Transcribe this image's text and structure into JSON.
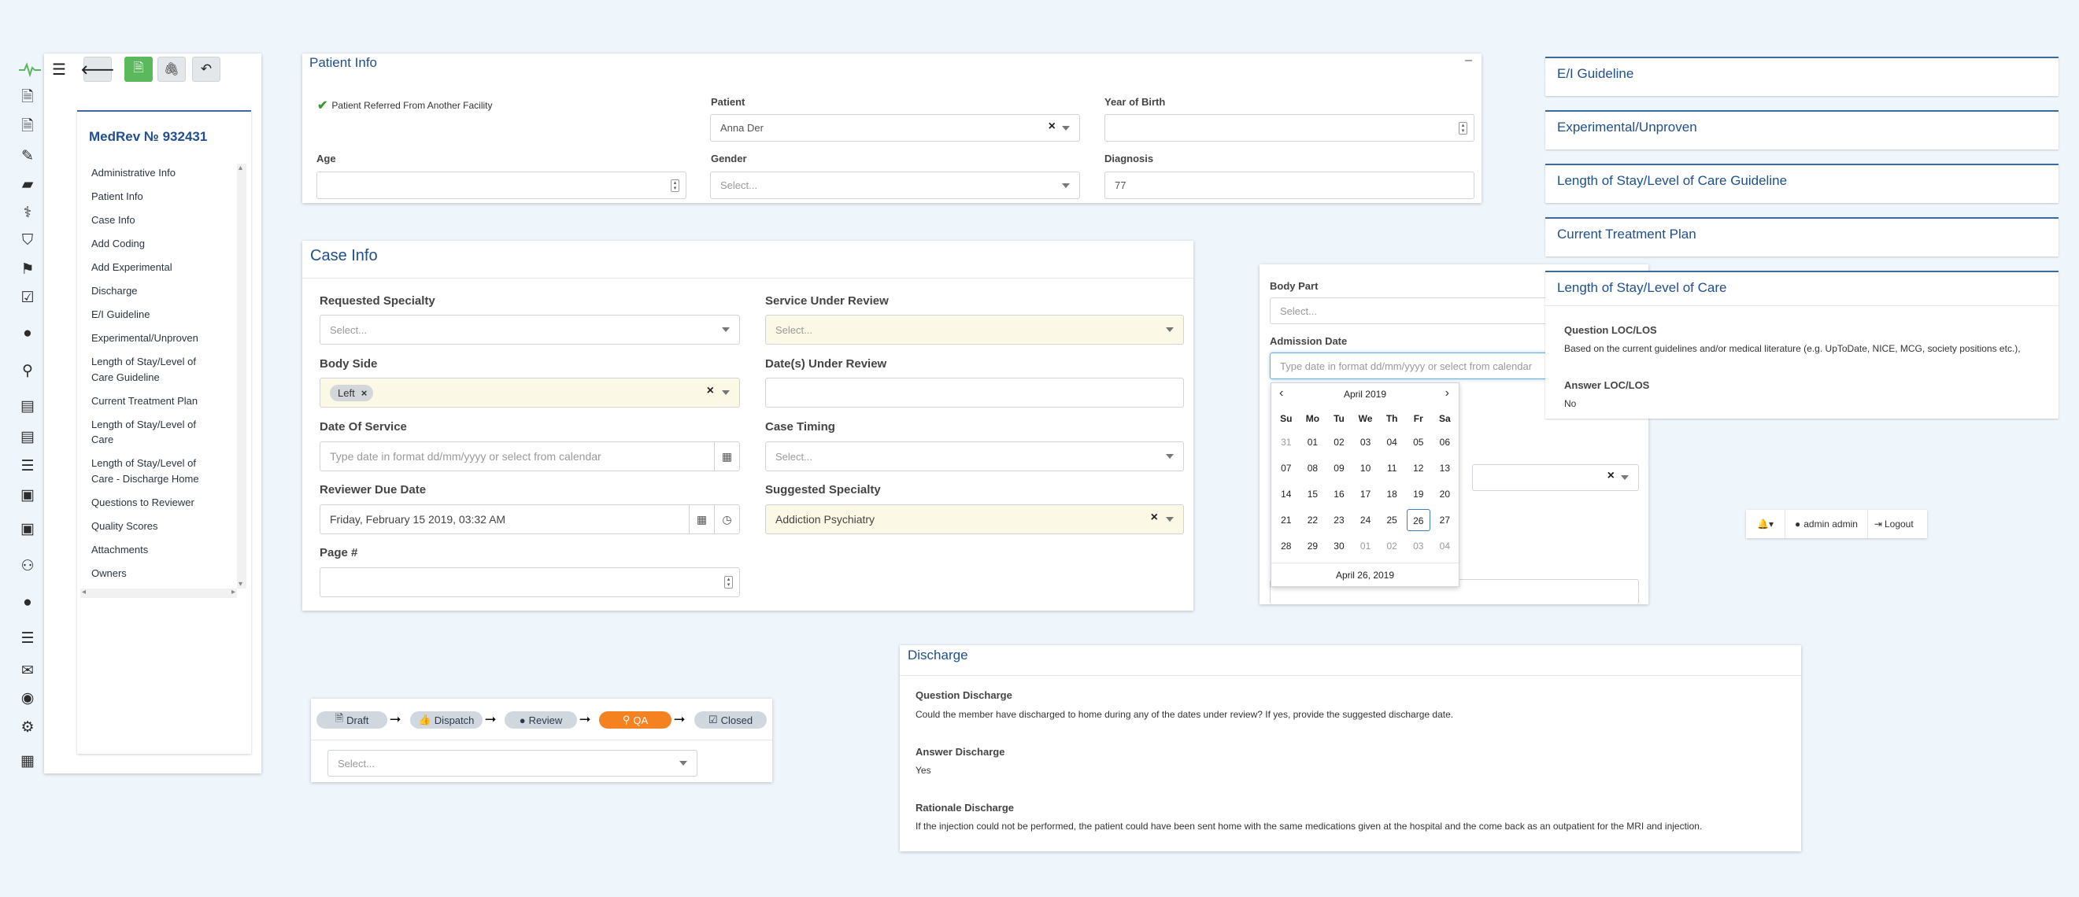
{
  "toolbar": {
    "menu_icon": "hamburger-icon",
    "back_icon": "arrow-left-icon",
    "file_icon": "file-icon",
    "attach_icon": "paperclip-icon",
    "undo_icon": "reply-icon"
  },
  "record": {
    "title": "MedRev № 932431"
  },
  "nav_items": [
    "Administrative Info",
    "Patient Info",
    "Case Info",
    "Add Coding",
    "Add Experimental",
    "Discharge",
    "E/I Guideline",
    "Experimental/Unproven",
    "Length of Stay/Level of",
    "Care Guideline",
    "Current Treatment Plan",
    "Length of Stay/Level of",
    "Care",
    "Length of Stay/Level of",
    "Care - Discharge Home",
    "Questions to Reviewer",
    "Quality Scores",
    "Attachments",
    "Owners"
  ],
  "patient_info": {
    "title": "Patient Info",
    "collapse": "–",
    "referred_label": "Patient Referred From Another Facility",
    "patient_label": "Patient",
    "patient_value": "Anna Der",
    "year_label": "Year of Birth",
    "age_label": "Age",
    "gender_label": "Gender",
    "gender_placeholder": "Select...",
    "diagnosis_label": "Diagnosis",
    "diagnosis_value": "77"
  },
  "case_info": {
    "title": "Case Info",
    "requested_specialty_label": "Requested Specialty",
    "requested_specialty_placeholder": "Select...",
    "service_label": "Service Under Review",
    "service_placeholder": "Select...",
    "body_side_label": "Body Side",
    "body_side_tag": "Left",
    "dates_label": "Date(s) Under Review",
    "date_of_service_label": "Date Of Service",
    "date_of_service_placeholder": "Type date in format dd/mm/yyyy or select from calendar",
    "case_timing_label": "Case Timing",
    "case_timing_placeholder": "Select...",
    "reviewer_due_label": "Reviewer Due Date",
    "reviewer_due_value": "Friday, February 15 2019, 03:32 AM",
    "suggested_label": "Suggested Specialty",
    "suggested_value": "Addiction Psychiatry",
    "page_label": "Page #"
  },
  "body_part": {
    "label": "Body Part",
    "placeholder": "Select...",
    "admission_label": "Admission Date",
    "admission_placeholder": "Type date in format dd/mm/yyyy or select from calendar"
  },
  "calendar": {
    "month": "April 2019",
    "prev": "‹",
    "next": "›",
    "weekdays": [
      "Su",
      "Mo",
      "Tu",
      "We",
      "Th",
      "Fr",
      "Sa"
    ],
    "weeks": [
      [
        "31",
        "01",
        "02",
        "03",
        "04",
        "05",
        "06"
      ],
      [
        "07",
        "08",
        "09",
        "10",
        "11",
        "12",
        "13"
      ],
      [
        "14",
        "15",
        "16",
        "17",
        "18",
        "19",
        "20"
      ],
      [
        "21",
        "22",
        "23",
        "24",
        "25",
        "26",
        "27"
      ],
      [
        "28",
        "29",
        "30",
        "01",
        "02",
        "03",
        "04"
      ]
    ],
    "muted": [
      [
        0,
        0
      ],
      [
        4,
        3
      ],
      [
        4,
        4
      ],
      [
        4,
        5
      ],
      [
        4,
        6
      ]
    ],
    "selected": [
      3,
      5
    ],
    "footer": "April 26, 2019"
  },
  "accordion": {
    "ei": "E/I Guideline",
    "exp": "Experimental/Unproven",
    "los_guideline": "Length of Stay/Level of Care Guideline",
    "ctp": "Current Treatment Plan",
    "los": "Length of Stay/Level of Care",
    "q_label": "Question LOC/LOS",
    "q_text": "Based on the current guidelines and/or medical literature (e.g. UpToDate, NICE, MCG, society positions etc.),",
    "a_label": "Answer LOC/LOS",
    "a_text": "No"
  },
  "user_bar": {
    "bell": "bell-icon",
    "user": "admin admin",
    "logout": "Logout"
  },
  "discharge": {
    "title": "Discharge",
    "q_label": "Question Discharge",
    "q_text": "Could the member have discharged to home during any of the dates under review? If yes, provide the suggested discharge date.",
    "a_label": "Answer Discharge",
    "a_text": "Yes",
    "r_label": "Rationale Discharge",
    "r_text": "If the injection could not be performed, the patient could have been sent home with the same medications given at the hospital and the come back as an outpatient for the MRI and injection."
  },
  "workflow": {
    "steps": [
      "Draft",
      "Dispatch",
      "Review",
      "QA",
      "Closed"
    ],
    "active": "QA",
    "select_placeholder": "Select..."
  },
  "colors": {
    "accent": "#1f4f8f",
    "active_step": "#f58220",
    "file_button": "#5cb85c",
    "highlight_field": "#fcf8e6"
  }
}
